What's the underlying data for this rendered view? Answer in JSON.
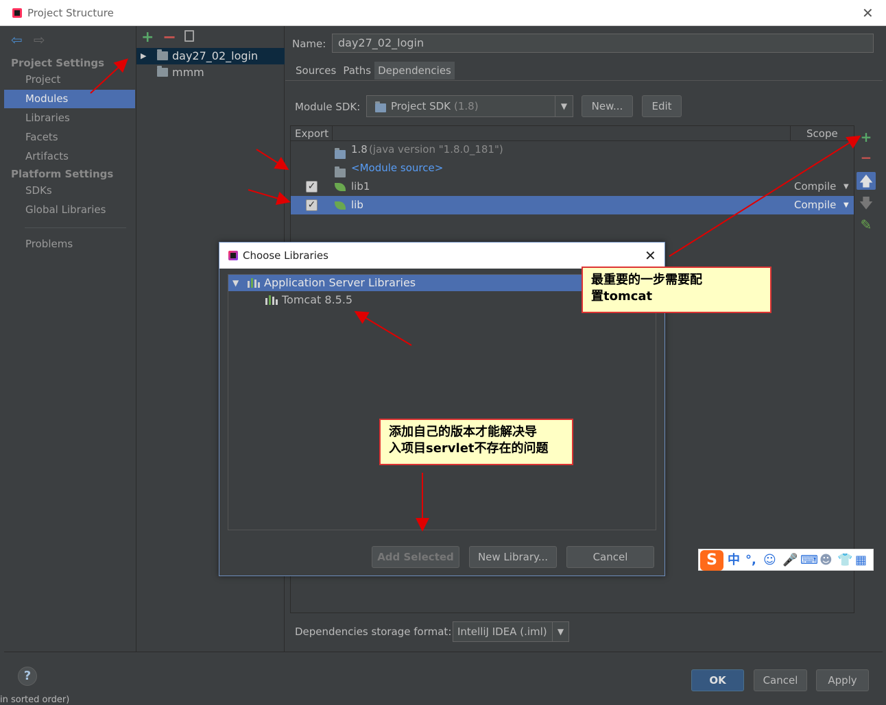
{
  "window": {
    "title": "Project Structure"
  },
  "left_nav": {
    "project_settings": "Project Settings",
    "project_items": [
      "Project",
      "Modules",
      "Libraries",
      "Facets",
      "Artifacts"
    ],
    "platform_settings": "Platform Settings",
    "platform_items": [
      "SDKs",
      "Global Libraries"
    ],
    "problems": "Problems",
    "selected": "Modules"
  },
  "module_tree": {
    "items": [
      "day27_02_login",
      "mmm"
    ],
    "selected": "day27_02_login"
  },
  "module_editor": {
    "name_label": "Name:",
    "name_value": "day27_02_login",
    "tabs": [
      "Sources",
      "Paths",
      "Dependencies"
    ],
    "active_tab": "Dependencies",
    "sdk_label": "Module SDK:",
    "sdk_value": "Project SDK",
    "sdk_version": "(1.8)",
    "new_button": "New...",
    "edit_button": "Edit",
    "table": {
      "headers": {
        "export": "Export",
        "scope": "Scope"
      },
      "rows": [
        {
          "name": "1.8",
          "detail": "(java version \"1.8.0_181\")",
          "checked": false,
          "scope": ""
        },
        {
          "name": "<Module source>",
          "detail": "",
          "checked": false,
          "scope": ""
        },
        {
          "name": "lib1",
          "detail": "",
          "checked": true,
          "scope": "Compile"
        },
        {
          "name": "lib",
          "detail": "",
          "checked": true,
          "scope": "Compile"
        }
      ]
    },
    "storage_label": "Dependencies storage format:",
    "storage_value": "IntelliJ IDEA (.iml)"
  },
  "dialog": {
    "title": "Choose Libraries",
    "group": "Application Server Libraries",
    "library": "Tomcat 8.5.5",
    "add_selected": "Add Selected",
    "new_library": "New Library...",
    "cancel": "Cancel"
  },
  "callouts": {
    "top_line1": "最重要的一步需要配",
    "top_line2": "置tomcat",
    "mid_line1": "添加自己的版本才能解决导",
    "mid_line2": "入项目servlet不存在的问题"
  },
  "footer": {
    "help": "?",
    "ok": "OK",
    "cancel": "Cancel",
    "apply": "Apply"
  },
  "ime": {
    "logo": "S",
    "mode": "中"
  },
  "colors": {
    "background": "#3c3f41",
    "selection": "#4b6eaf",
    "accent_green": "#59a869",
    "accent_red": "#c75450",
    "link": "#589df6",
    "annotation": "#e00000"
  },
  "overflow_text": "in sorted order)"
}
